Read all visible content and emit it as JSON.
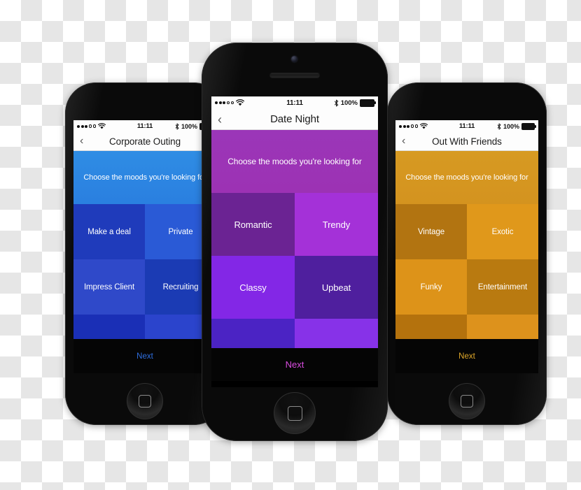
{
  "phones": [
    {
      "id": "left",
      "status_bar": {
        "signal_filled": 3,
        "signal_hollow": 2,
        "wifi_icon": "wifi-icon",
        "time": "11:11",
        "bluetooth_icon": "bluetooth-icon",
        "battery_percent": "100%",
        "battery_icon": "battery-full-icon"
      },
      "nav": {
        "back_icon": "chevron-left-icon",
        "title": "Corporate Outing"
      },
      "banner": {
        "text": "Choose the moods you're looking for",
        "bg_top": "#2f8de4",
        "bg_bottom": "#2a7fe0"
      },
      "tiles": [
        {
          "label": "Make a deal",
          "color": "#1f3bbb"
        },
        {
          "label": "Private",
          "color": "#2a5ad6"
        },
        {
          "label": "Impress Client",
          "color": "#2f49c9"
        },
        {
          "label": "Recruiting",
          "color": "#1b3bb4"
        },
        {
          "label": "",
          "color": "#1a2fb6"
        },
        {
          "label": "",
          "color": "#2b44cc"
        }
      ],
      "next": {
        "label": "Next",
        "color": "#2f6fe0",
        "bg": "#050505"
      }
    },
    {
      "id": "center",
      "status_bar": {
        "signal_filled": 3,
        "signal_hollow": 2,
        "wifi_icon": "wifi-icon",
        "time": "11:11",
        "bluetooth_icon": "bluetooth-icon",
        "battery_percent": "100%",
        "battery_icon": "battery-full-icon"
      },
      "nav": {
        "back_icon": "chevron-left-icon",
        "title": "Date Night"
      },
      "banner": {
        "text": "Choose the moods you're looking for",
        "bg_top": "#9b36b8",
        "bg_bottom": "#9c32b4"
      },
      "tiles": [
        {
          "label": "Romantic",
          "color": "#6b2393"
        },
        {
          "label": "Trendy",
          "color": "#a431d8"
        },
        {
          "label": "Classy",
          "color": "#8327e6"
        },
        {
          "label": "Upbeat",
          "color": "#4f1f9e"
        },
        {
          "label": "",
          "color": "#4b23c4"
        },
        {
          "label": "",
          "color": "#8732e8"
        }
      ],
      "next": {
        "label": "Next",
        "color": "#d94ce0",
        "bg": "#050505"
      }
    },
    {
      "id": "right",
      "status_bar": {
        "signal_filled": 3,
        "signal_hollow": 2,
        "wifi_icon": "wifi-icon",
        "time": "11:11",
        "bluetooth_icon": "bluetooth-icon",
        "battery_percent": "100%",
        "battery_icon": "battery-full-icon"
      },
      "nav": {
        "back_icon": "chevron-left-icon",
        "title": "Out With Friends"
      },
      "banner": {
        "text": "Choose the moods you're looking for",
        "bg_top": "#d79a22",
        "bg_bottom": "#d4931f"
      },
      "tiles": [
        {
          "label": "Vintage",
          "color": "#b27411"
        },
        {
          "label": "Exotic",
          "color": "#e0981b"
        },
        {
          "label": "Funky",
          "color": "#dd9319"
        },
        {
          "label": "Entertainment",
          "color": "#b97a10"
        },
        {
          "label": "",
          "color": "#b4720d"
        },
        {
          "label": "",
          "color": "#dd921c"
        }
      ],
      "next": {
        "label": "Next",
        "color": "#e0a82a",
        "bg": "#050505"
      }
    }
  ]
}
